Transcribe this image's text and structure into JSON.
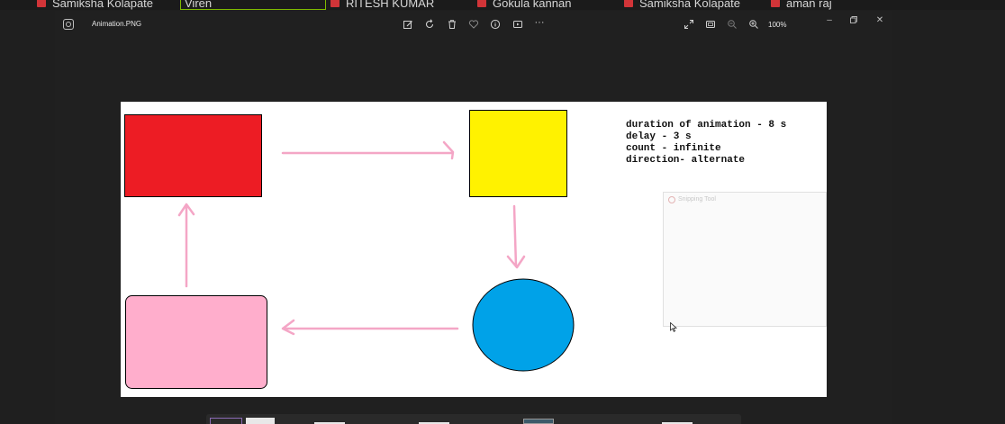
{
  "participants": [
    {
      "name": "Samiksha Kolapate"
    },
    {
      "name": "Viren"
    },
    {
      "name": "RITESH KUMAR"
    },
    {
      "name": "Gokula kannan"
    },
    {
      "name": "Samiksha Kolapate"
    },
    {
      "name": "aman raj"
    }
  ],
  "photos_app": {
    "file_name": "Animation.PNG",
    "zoom_level": "100%",
    "toolbar_icons": [
      "edit-icon",
      "rotate-icon",
      "delete-icon",
      "favorite-icon",
      "info-icon",
      "slideshow-icon",
      "more-icon"
    ],
    "view_icons": [
      "expand-icon",
      "fit-icon",
      "zoom-out-icon",
      "zoom-in-icon"
    ]
  },
  "image": {
    "notes": [
      "duration of animation - 8 s",
      "delay - 3 s",
      "count - infinite",
      "direction- alternate"
    ],
    "colors": {
      "red_box": "#ed1c24",
      "yellow_box": "#fff200",
      "blue_circle": "#00a2e8",
      "pink_box": "#ffaecc",
      "arrow": "#f4a6c6"
    }
  },
  "snipping_tool": {
    "label": "Snipping Tool"
  }
}
